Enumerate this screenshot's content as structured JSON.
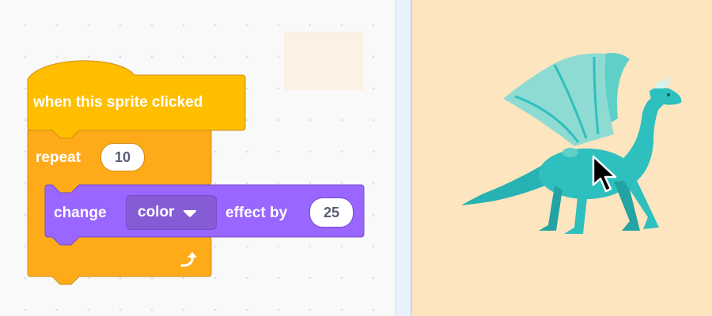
{
  "code_area": {
    "hat_block": {
      "label": "when this sprite clicked"
    },
    "repeat_block": {
      "label": "repeat",
      "count": "10"
    },
    "effect_block": {
      "label_change": "change",
      "effect_option": "color",
      "label_effect_by": "effect by",
      "amount": "25"
    }
  },
  "colors": {
    "events": "#ffbf00",
    "control": "#ffab19",
    "looks": "#9966ff",
    "stage_bg": "#fde5bf",
    "sprite": "#2ebfbf"
  },
  "stage": {
    "sprite_icon": "dragon-sprite",
    "cursor_icon": "mouse-pointer-icon"
  }
}
